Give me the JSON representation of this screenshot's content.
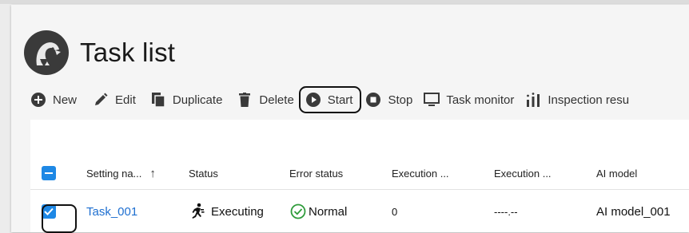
{
  "page": {
    "title": "Task list"
  },
  "toolbar": {
    "new_label": "New",
    "edit_label": "Edit",
    "duplicate_label": "Duplicate",
    "delete_label": "Delete",
    "start_label": "Start",
    "stop_label": "Stop",
    "task_monitor_label": "Task monitor",
    "inspection_label": "Inspection resu"
  },
  "table": {
    "columns": [
      "Setting na...",
      "Status",
      "Error status",
      "Execution ...",
      "Execution ...",
      "AI model"
    ],
    "sort_indicator": "↑",
    "rows": [
      {
        "setting_name": "Task_001",
        "status": "Executing",
        "error_status": "Normal",
        "execution_1": "0",
        "execution_2": "----.--",
        "ai_model": "AI model_001",
        "checked": true
      }
    ]
  },
  "colors": {
    "accent": "#1e88e5",
    "link": "#1e6fd0",
    "ok": "#2e9b3a"
  }
}
